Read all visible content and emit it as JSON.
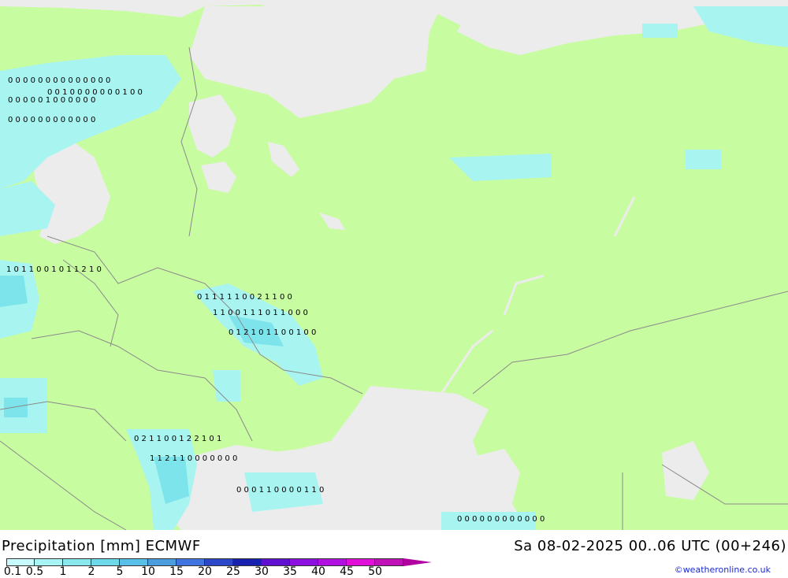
{
  "map": {
    "title": "Precipitation [mm] ECMWF",
    "datetime": "Sa 08-02-2025 00..06 UTC (00+246)",
    "credit": "©weatheronline.co.uk",
    "colors": {
      "land": "#c8fca0",
      "sea": "#ececec",
      "border": "#8a8a8a",
      "precip_light": "#a8f4f0"
    },
    "legend": {
      "ticks": [
        "0.1",
        "0.5",
        "1",
        "2",
        "5",
        "10",
        "15",
        "20",
        "25",
        "30",
        "35",
        "40",
        "45",
        "50"
      ],
      "colors": [
        "#c8fcfc",
        "#a8f4f4",
        "#88e8ec",
        "#6cd8e8",
        "#58c0e8",
        "#4c9ce0",
        "#4074e0",
        "#2c48c8",
        "#1820b0",
        "#6010d0",
        "#8c10e0",
        "#b010e0",
        "#e010d8",
        "#c010b8"
      ]
    },
    "values_rows": [
      "0 0 0 0 0 0 0 0 0 0 0 0 0 0",
      "0 0 0 0 0 1 0 0 0 0 0 0",
      "0 0 0 0 0 0 0 0 0 0 0 0",
      "0 0 1 0 0 0 0 0 0 0 1 0 0",
      "1 0 1 1 0 0 1 0 1 1 2 1 0",
      "0 1 1 1 1 1 0 0 2 1 1 0 0",
      "1 1 0 0 1 1 1 0 1 1 0 0 0",
      "0 1 2 1 0 1 1 0 0 1 0 0",
      "0 2 1 1 0 0 1 2 2 1 0 1",
      "1 1 2 1 1 0 0 0 0 0 0 0",
      "0 0 0 1 1 0 0 0 0 1 1 0",
      "0 0 0 0 0 0 0 0 0 0 0 0"
    ]
  }
}
